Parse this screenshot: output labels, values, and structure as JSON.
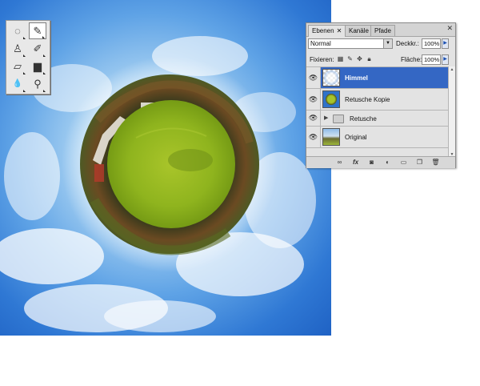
{
  "toolbox": {
    "tools": [
      {
        "name": "lasso-tool",
        "glyph": "◌",
        "active": false
      },
      {
        "name": "brush-tool",
        "glyph": "✎",
        "active": true
      },
      {
        "name": "clone-stamp-tool",
        "glyph": "♙",
        "active": false
      },
      {
        "name": "history-brush-tool",
        "glyph": "✐",
        "active": false
      },
      {
        "name": "eraser-tool",
        "glyph": "▱",
        "active": false
      },
      {
        "name": "gradient-tool",
        "glyph": "▆",
        "active": false
      },
      {
        "name": "blur-tool",
        "glyph": "💧",
        "active": false
      },
      {
        "name": "dodge-tool",
        "glyph": "⚲",
        "active": false
      }
    ]
  },
  "layers_panel": {
    "tabs": [
      {
        "label": "Ebenen",
        "active": true
      },
      {
        "label": "Kanäle",
        "active": false
      },
      {
        "label": "Pfade",
        "active": false
      }
    ],
    "blend_mode": "Normal",
    "opacity_label": "Deckkr.:",
    "opacity_value": "100%",
    "lock_label": "Fixieren:",
    "fill_label": "Fläche:",
    "fill_value": "100%",
    "layers": [
      {
        "name": "Himmel",
        "selected": true,
        "type": "layer"
      },
      {
        "name": "Retusche Kopie",
        "selected": false,
        "type": "layer"
      },
      {
        "name": "Retusche",
        "selected": false,
        "type": "group"
      },
      {
        "name": "Original",
        "selected": false,
        "type": "layer"
      }
    ],
    "bottom_icons": [
      "link-icon",
      "fx-icon",
      "mask-icon",
      "adjustment-icon",
      "folder-icon",
      "new-layer-icon",
      "trash-icon"
    ]
  }
}
